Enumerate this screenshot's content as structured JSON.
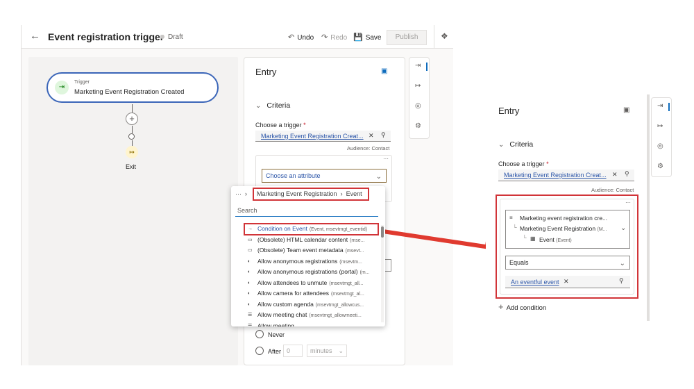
{
  "header": {
    "title": "Event registration trigger",
    "status": "Draft",
    "undo": "Undo",
    "redo": "Redo",
    "save": "Save",
    "publish": "Publish"
  },
  "canvas": {
    "trigger_small": "Trigger",
    "trigger_name": "Marketing Event Registration Created",
    "exit": "Exit"
  },
  "entry_panel": {
    "title": "Entry",
    "criteria": "Criteria",
    "choose_trigger_label": "Choose a trigger",
    "required_mark": "*",
    "trigger_value": "Marketing Event Registration Creat...",
    "audience": "Audience: Contact",
    "more": "···",
    "attribute_placeholder": "Choose an attribute"
  },
  "popup": {
    "breadcrumb_more": "···",
    "breadcrumb_1": "Marketing Event Registration",
    "breadcrumb_2": "Event",
    "search_placeholder": "Search",
    "items": [
      {
        "label": "Condition on Event",
        "sub": "(Event, msevtmgt_eventid)",
        "icon": "→"
      },
      {
        "label": "(Obsolete) HTML calendar content",
        "sub": "(mse...",
        "icon": "▭"
      },
      {
        "label": "(Obsolete) Team event metadata",
        "sub": "(msevt...",
        "icon": "▭"
      },
      {
        "label": "Allow anonymous registrations",
        "sub": "(msevtm...",
        "icon": "◐"
      },
      {
        "label": "Allow anonymous registrations (portal)",
        "sub": "(m...",
        "icon": "◐"
      },
      {
        "label": "Allow attendees to unmute",
        "sub": "(msevtmgt_all...",
        "icon": "◐"
      },
      {
        "label": "Allow camera for attendees",
        "sub": "(msevtmgt_al...",
        "icon": "◐"
      },
      {
        "label": "Allow custom agenda",
        "sub": "(msevtmgt_allowcus...",
        "icon": "◐"
      },
      {
        "label": "Allow meeting chat",
        "sub": "(msevtmgt_allowmeeti...",
        "icon": "☰"
      },
      {
        "label": "Allow meeting...",
        "sub": "",
        "icon": "☰"
      }
    ]
  },
  "timing": {
    "never": "Never",
    "after": "After",
    "after_value": "0",
    "unit": "minutes"
  },
  "right_panel": {
    "title": "Entry",
    "criteria": "Criteria",
    "choose_trigger_label": "Choose a trigger",
    "required_mark": "*",
    "trigger_value": "Marketing Event Registration Creat...",
    "audience": "Audience: Contact",
    "more": "···",
    "path_1": "Marketing event registration cre...",
    "path_2": "Marketing Event Registration",
    "path_2_sub": "(M...",
    "path_3": "Event",
    "path_3_sub": "(Event)",
    "operator": "Equals",
    "value_tag": "An eventful event",
    "add_condition": "Add condition"
  },
  "colors": {
    "accent": "#0f6cbd",
    "highlight": "#d13438",
    "arrow": "#e03a2f",
    "trigger_border": "#3a65b8"
  }
}
